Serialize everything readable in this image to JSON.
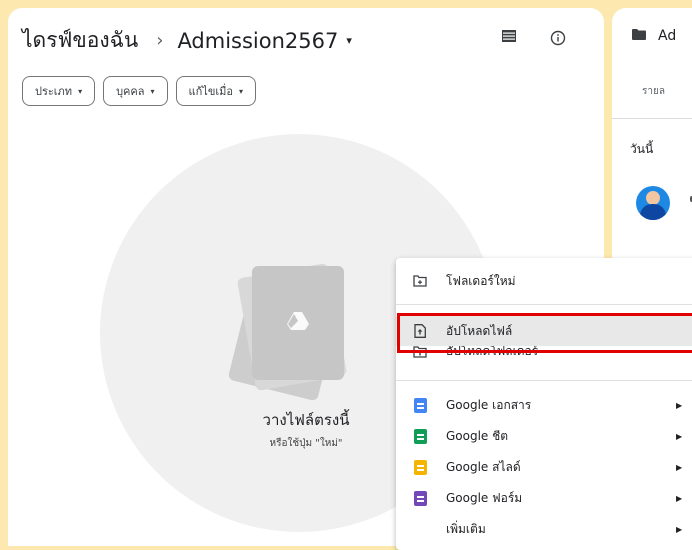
{
  "breadcrumb": {
    "root": "ไดรฟ์ของฉัน",
    "separator": "›",
    "current": "Admission2567",
    "caret": "▾"
  },
  "toolbar": {
    "list_view_icon": "list-view-icon",
    "info_icon": "info-icon"
  },
  "filters": [
    {
      "label": "ประเภท",
      "caret": "▾"
    },
    {
      "label": "บุคคล",
      "caret": "▾"
    },
    {
      "label": "แก้ไขเมื่อ",
      "caret": "▾"
    }
  ],
  "empty_state": {
    "title": "วางไฟล์ตรงนี้",
    "subtitle": "หรือใช้ปุ่ม \"ใหม่\""
  },
  "side_panel": {
    "folder_name": "Ad",
    "tab_label": "รายล",
    "section_today": "วันนี้"
  },
  "new_menu": {
    "items": [
      {
        "label": "โฟลเดอร์ใหม่",
        "icon": "new-folder-icon"
      },
      {
        "label": "อัปโหลดไฟล์",
        "icon": "file-upload-icon"
      },
      {
        "label": "อัปโหลดโฟลเดอร์",
        "icon": "folder-upload-icon"
      },
      {
        "label": "Google เอกสาร",
        "icon": "google-docs-icon",
        "color": "#4285f4",
        "arrow": "▶"
      },
      {
        "label": "Google ชีต",
        "icon": "google-sheets-icon",
        "color": "#0f9d58",
        "arrow": "▶"
      },
      {
        "label": "Google สไลด์",
        "icon": "google-slides-icon",
        "color": "#f4b400",
        "arrow": "▶"
      },
      {
        "label": "Google ฟอร์ม",
        "icon": "google-forms-icon",
        "color": "#7248b9",
        "arrow": "▶"
      },
      {
        "label": "เพิ่มเติม",
        "icon": "more-icon",
        "arrow": "▶"
      }
    ]
  },
  "colors": {
    "background": "#fde9b0",
    "highlight_border": "#e00000",
    "menu_highlight": "#e8e8e8"
  }
}
